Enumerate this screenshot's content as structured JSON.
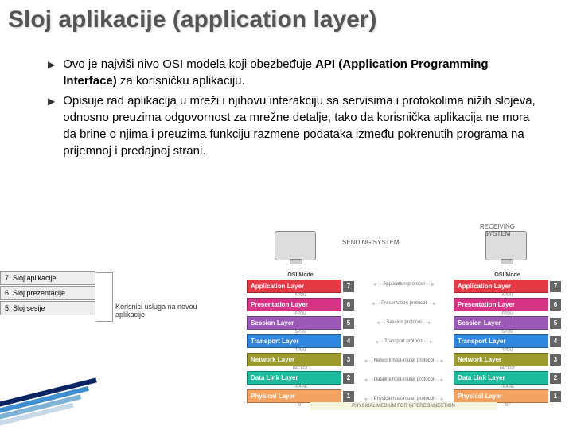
{
  "title": "Sloj aplikacije (application layer)",
  "bullets": [
    {
      "pre": "Ovo je najviši nivo OSI modela koji obezbeđuje ",
      "bold": "API (Application Programming Interface)",
      "post": " za korisničku aplikaciju."
    },
    {
      "pre": "Opisuje rad aplikacija u mreži i njihovu interakciju sa servisima i protokolima nižih slojeva, odnosno preuzima odgovornost za mrežne detalje, tako da korisnička aplikacija ne mora da brine o njima i preuzima funkciju razmene podataka između pokrenutih programa na prijemnoj i predajnoj strani.",
      "bold": "",
      "post": ""
    }
  ],
  "left_diagram": {
    "boxes": [
      "7. Sloj aplikacije",
      "6. Sloj prezentacije",
      "5. Sloj sesije"
    ],
    "caption": "Korisnici usluga na novou aplikacije"
  },
  "right_diagram": {
    "sending": "SENDING SYSTEM",
    "receiving": "RECEIVING SYSTEM",
    "osi_header": "OSI Mode",
    "layers": [
      {
        "name": "Application Layer",
        "num": "7",
        "cls": "l7",
        "pdu": "APDU",
        "proto": "Application protocol"
      },
      {
        "name": "Presentation Layer",
        "num": "6",
        "cls": "l6",
        "pdu": "PPDU",
        "proto": "Presentation protocol"
      },
      {
        "name": "Session Layer",
        "num": "5",
        "cls": "l5",
        "pdu": "SPDU",
        "proto": "Session protocol"
      },
      {
        "name": "Transport Layer",
        "num": "4",
        "cls": "l4",
        "pdu": "TPDU",
        "proto": "Transport protocol"
      },
      {
        "name": "Network Layer",
        "num": "3",
        "cls": "l3",
        "pdu": "PACKET",
        "proto": "Network host-router protocol"
      },
      {
        "name": "Data Link Layer",
        "num": "2",
        "cls": "l2",
        "pdu": "FRAME",
        "proto": "Datalink host-router protocol"
      },
      {
        "name": "Physical Layer",
        "num": "1",
        "cls": "l1",
        "pdu": "BIT",
        "proto": "Physical host-router protocol"
      }
    ],
    "medium": "PHYSICAL MEDIUM FOR INTERCONNECTION"
  }
}
